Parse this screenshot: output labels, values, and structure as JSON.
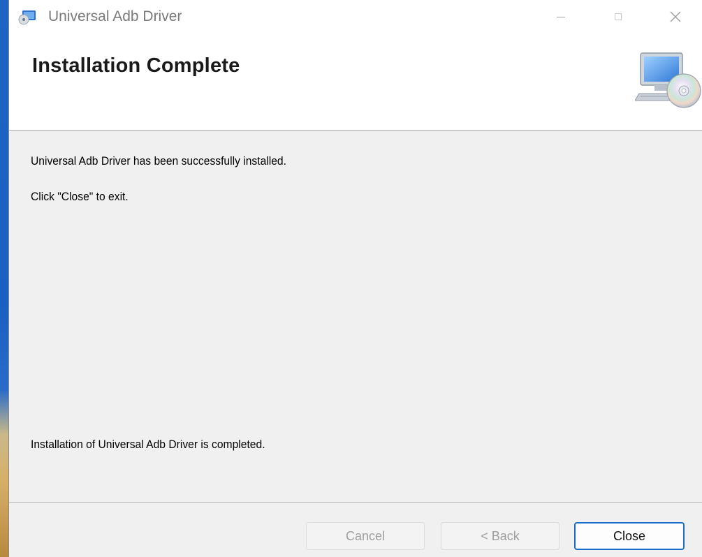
{
  "window": {
    "title": "Universal Adb Driver",
    "controls": {
      "minimize": "minimize-icon",
      "maximize": "maximize-icon",
      "close": "close-icon"
    }
  },
  "header": {
    "title": "Installation Complete",
    "art_icon": "computer-cd-icon"
  },
  "content": {
    "line1": "Universal Adb Driver has been successfully installed.",
    "line2": "Click \"Close\" to exit.",
    "status": "Installation of Universal Adb Driver is completed."
  },
  "buttons": {
    "cancel_label": "Cancel",
    "back_label": "< Back",
    "close_label": "Close"
  },
  "colors": {
    "accent": "#1a6dc9",
    "background": "#f0f0f0",
    "banner": "#ffffff"
  }
}
